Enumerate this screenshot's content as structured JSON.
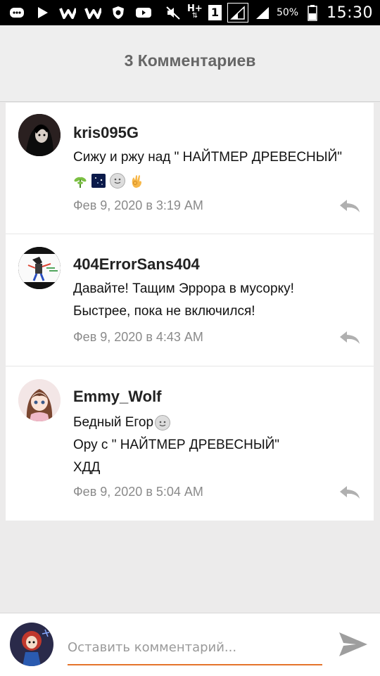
{
  "status_bar": {
    "network": "H+",
    "sim_slot": "1",
    "battery": "50%",
    "time": "15:30"
  },
  "header": {
    "title": "3 Комментариев"
  },
  "comments": [
    {
      "author": "kris095G",
      "text": "Сижу и ржу над \" НАЙТМЕР ДРЕВЕСНЫЙ\"",
      "emojis": [
        "seedling",
        "night-sky",
        "slight-smile",
        "ok-hand"
      ],
      "date": "Фев 9, 2020 в 3:19 AM"
    },
    {
      "author": "404ErrorSans404",
      "text": "Давайте! Тащим Эррора в мусорку!\nБыстрее, пока не включился!",
      "date": "Фев 9, 2020 в 4:43 AM"
    },
    {
      "author": "Emmy_Wolf",
      "line1": "Бедный Егор",
      "line1_emoji": "slight-smile",
      "line2": "Ору с \" НАЙТМЕР ДРЕВЕСНЫЙ\"",
      "line3": "ХДД",
      "date": "Фев 9, 2020 в 5:04 AM"
    }
  ],
  "footer": {
    "placeholder": "Оставить комментарий..."
  },
  "colors": {
    "accent": "#e5742b",
    "icon_gray": "#9e9e9e"
  }
}
